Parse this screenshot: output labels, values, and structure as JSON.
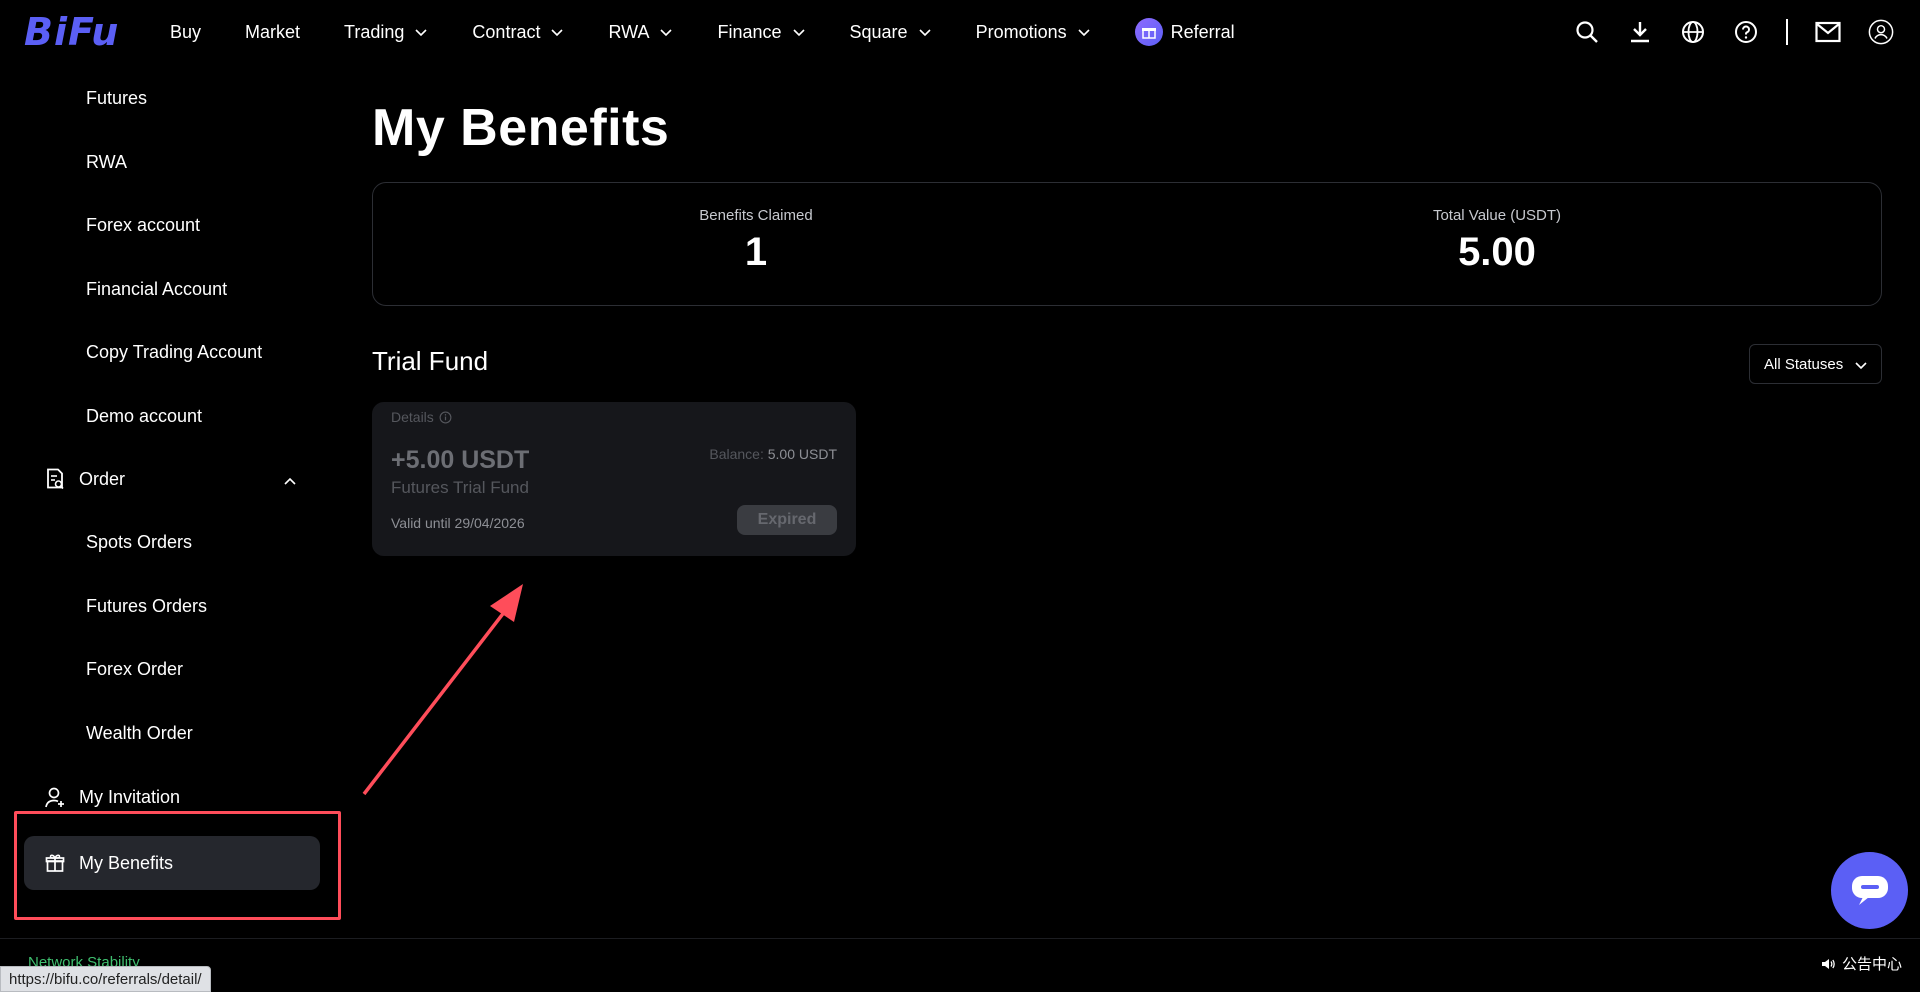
{
  "brand": {
    "logo_text": "BiFu",
    "accent": "#5b5ff5"
  },
  "nav": {
    "items": [
      {
        "label": "Buy",
        "dropdown": false
      },
      {
        "label": "Market",
        "dropdown": false
      },
      {
        "label": "Trading",
        "dropdown": true
      },
      {
        "label": "Contract",
        "dropdown": true
      },
      {
        "label": "RWA",
        "dropdown": true
      },
      {
        "label": "Finance",
        "dropdown": true
      },
      {
        "label": "Square",
        "dropdown": true
      },
      {
        "label": "Promotions",
        "dropdown": true
      }
    ],
    "referral_label": "Referral",
    "right_icons": [
      "search-icon",
      "download-icon",
      "globe-icon",
      "help-icon",
      "mail-icon",
      "user-icon"
    ]
  },
  "sidebar": {
    "account_sub_items": [
      "Futures",
      "RWA",
      "Forex account",
      "Financial Account",
      "Copy Trading Account",
      "Demo account"
    ],
    "order_label": "Order",
    "order_sub_items": [
      "Spots Orders",
      "Futures Orders",
      "Forex Order",
      "Wealth Order"
    ],
    "invitation_label": "My Invitation",
    "benefits_label": "My Benefits"
  },
  "main": {
    "title": "My Benefits",
    "stats": {
      "claimed_label": "Benefits Claimed",
      "claimed_value": "1",
      "total_label": "Total Value (USDT)",
      "total_value": "5.00"
    },
    "section_title": "Trial Fund",
    "status_filter": "All Statuses",
    "fund_card": {
      "details_label": "Details",
      "amount": "+5.00 USDT",
      "name": "Futures Trial Fund",
      "valid": "Valid until 29/04/2026",
      "balance_label": "Balance:",
      "balance_value": "5.00 USDT",
      "status": "Expired"
    }
  },
  "footer": {
    "network_status": "Network Stability",
    "announcement": "公告中心",
    "url": "https://bifu.co/referrals/detail/"
  }
}
